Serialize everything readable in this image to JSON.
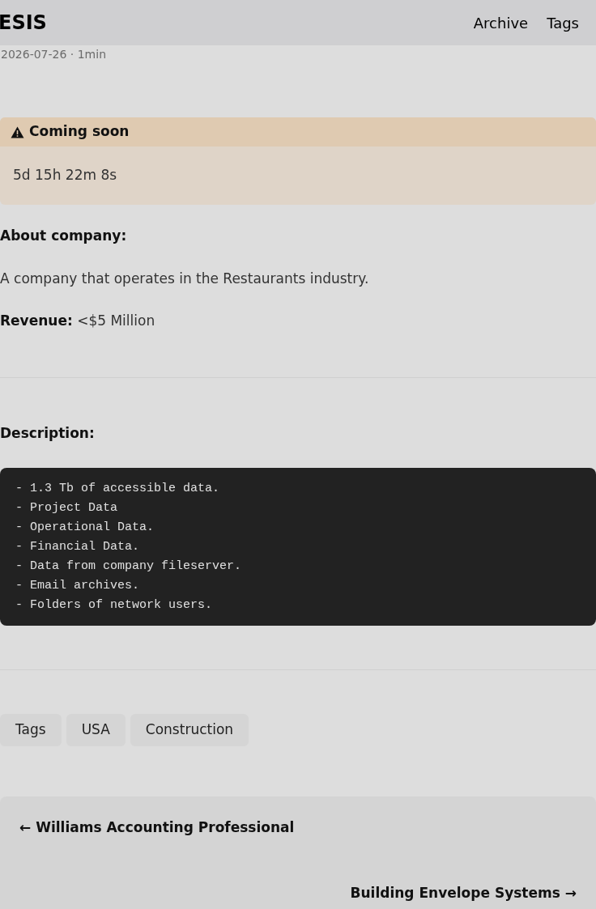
{
  "header": {
    "title": "ESIS",
    "nav": [
      "Archive",
      "Tags"
    ]
  },
  "meta": "2026-07-26 · 1min",
  "notice": {
    "title": "Coming soon",
    "countdown": "5d 15h 22m 8s"
  },
  "about": {
    "heading": "About company:",
    "text": "A company that operates in the Restaurants industry.",
    "revenue_label": "Revenue:",
    "revenue_value": "<$5 Million"
  },
  "description": {
    "heading": "Description:",
    "lines": [
      "- 1.3 Tb of accessible data.",
      "- Project Data",
      "- Operational Data.",
      "- Financial Data.",
      "- Data from company fileserver.",
      "- Email archives.",
      "- Folders of network users."
    ]
  },
  "tags": [
    "Tags",
    "USA",
    "Construction"
  ],
  "pagination": {
    "prev": "← Williams Accounting Professional",
    "next": "Building Envelope Systems →"
  }
}
